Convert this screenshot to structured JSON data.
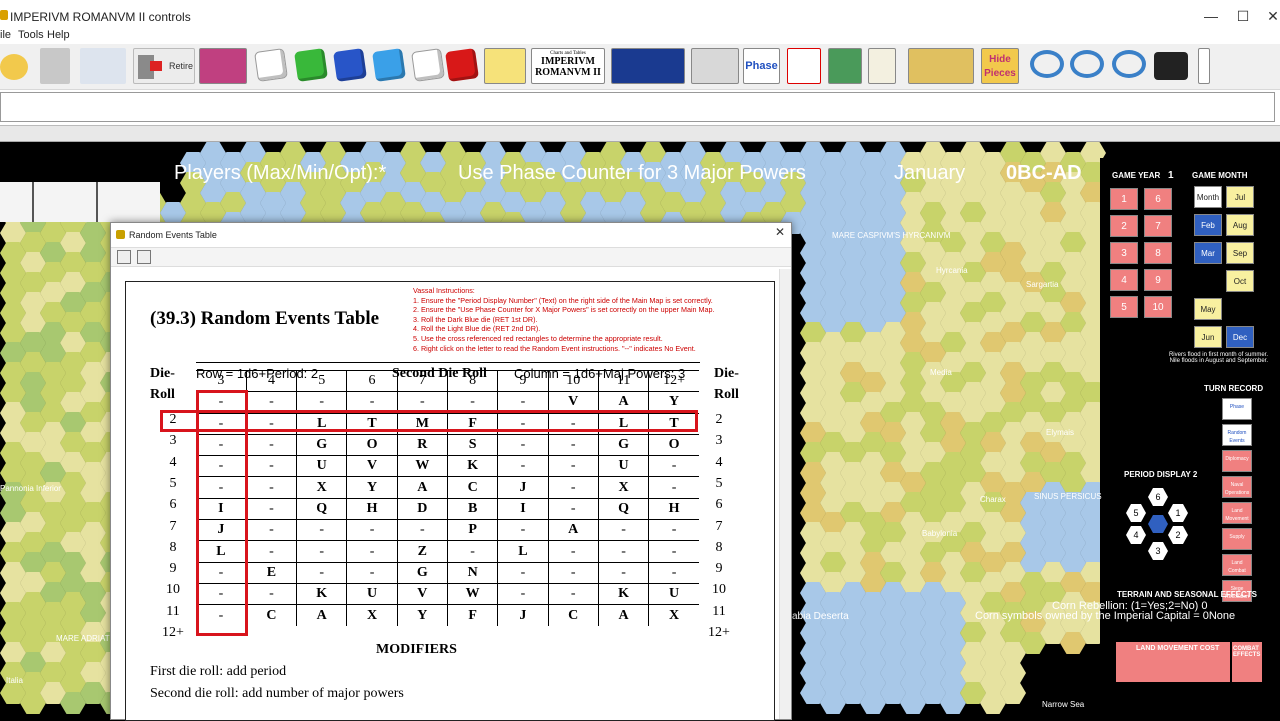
{
  "window": {
    "title": "IMPERIVM ROMANVM II controls",
    "minimize": "—",
    "maximize": "☐",
    "close": "✕"
  },
  "menu": [
    "ile",
    "Tools",
    "Help"
  ],
  "toolbar": {
    "retire_label": "Retire",
    "phase_label": "Phase",
    "charts_label": "Charts and Tables",
    "imperivm_label": "IMPERIVM ROMANVM II",
    "hide_label": "Hide Pieces"
  },
  "map": {
    "players_label": "Players (Max/Min/Opt):*",
    "phase_counter_label": "Use Phase Counter for 3 Major Powers",
    "month": "January",
    "year": "0BC-AD",
    "game_year_label": "GAME YEAR",
    "game_year_value": "1",
    "game_month_label": "GAME MONTH",
    "year_boxes": [
      "1",
      "6",
      "2",
      "7",
      "3",
      "8",
      "4",
      "9",
      "5",
      "10"
    ],
    "month_boxes": [
      "Month",
      "Jul",
      "Feb",
      "Aug",
      "Mar",
      "Sep",
      "Oct",
      "May",
      "Jun",
      "Dec"
    ],
    "nile_note": "Rivers flood in first month of summer. Nile floods in August and September.",
    "turn_record_label": "TURN RECORD",
    "turn_boxes": [
      "Phase",
      "Random Events",
      "Diplomacy",
      "Naval Operations",
      "Land Movement",
      "Supply",
      "Land Combat",
      "Siege Resolution"
    ],
    "period_display_label": "PERIOD DISPLAY 2",
    "period_numbers": [
      "6",
      "5",
      "1",
      "4",
      "2",
      "3"
    ],
    "corn_rebellion": "Corn Rebellion: (1=Yes;2=No) 0",
    "corn_symbols": "Corn  symbols owned by the Imperial Capital = 0None",
    "terrain_label": "TERRAIN AND SEASONAL EFFECTS",
    "land_movement_cost": "LAND MOVEMENT COST",
    "combat_effects": "COMBAT EFFECTS",
    "places": [
      "MARE CASPIVM'S HYRCANIVM",
      "Hyrcania",
      "Sargartia",
      "Media",
      "Elymais",
      "Babylonia",
      "Charax",
      "SINUS PERSICUS",
      "abia Deserta",
      "Pannonia Inferior",
      "MARE ADRIATICUM",
      "Italia",
      "Narrow Sea"
    ],
    "colors": {
      "land": "#c8d36a",
      "land2": "#e6e2a0",
      "sea": "#a8c8e8",
      "deep": "#6aa0d8",
      "box_red": "#f08080",
      "box_blue": "#3060c0",
      "box_yellow": "#f8f0a0"
    }
  },
  "dialog": {
    "title": "Random Events Table",
    "close": "✕",
    "heading": "(39.3) Random Events Table",
    "instructions": [
      "Vassal Instructions:",
      "1.  Ensure the \"Period Display Number\" (Text) on the right side of the Main Map is set correctly.",
      "2.  Ensure the \"Use Phase Counter for X Major Powers\" is set correctly on the upper Main Map.",
      "3.  Roll the Dark Blue die (RET 1st DR).",
      "4.  Roll the Light Blue die (RET 2nd DR).",
      "5.  Use the cross referenced red rectangles to determine the appropriate result.",
      "6.  Right click on the letter to read the Random Event instructions.          \"--\" indicates No Event."
    ],
    "die_roll_left": [
      "Die-",
      "Roll"
    ],
    "die_roll_right": [
      "Die-",
      "Roll"
    ],
    "row_label": "Row = 1d6+Period: 2",
    "second_die_label": "Second Die Roll",
    "column_label": "Column = 1d6+Maj Powers: 3",
    "columns": [
      "3",
      "4",
      "5",
      "6",
      "7",
      "8",
      "9",
      "10",
      "11",
      "12+"
    ],
    "rows": [
      {
        "roll": "2",
        "cells": [
          "-",
          "-",
          "-",
          "-",
          "-",
          "-",
          "-",
          "V",
          "A",
          "Y"
        ]
      },
      {
        "roll": "3",
        "cells": [
          "-",
          "-",
          "L",
          "T",
          "M",
          "F",
          "-",
          "-",
          "L",
          "T"
        ]
      },
      {
        "roll": "4",
        "cells": [
          "-",
          "-",
          "G",
          "O",
          "R",
          "S",
          "-",
          "-",
          "G",
          "O"
        ]
      },
      {
        "roll": "5",
        "cells": [
          "-",
          "-",
          "U",
          "V",
          "W",
          "K",
          "-",
          "-",
          "U",
          "-"
        ]
      },
      {
        "roll": "6",
        "cells": [
          "-",
          "-",
          "X",
          "Y",
          "A",
          "C",
          "J",
          "-",
          "X",
          "-"
        ]
      },
      {
        "roll": "7",
        "cells": [
          "I",
          "-",
          "Q",
          "H",
          "D",
          "B",
          "I",
          "-",
          "Q",
          "H"
        ]
      },
      {
        "roll": "8",
        "cells": [
          "J",
          "-",
          "-",
          "-",
          "-",
          "P",
          "-",
          "A",
          "-",
          "-"
        ]
      },
      {
        "roll": "9",
        "cells": [
          "L",
          "-",
          "-",
          "-",
          "Z",
          "-",
          "L",
          "-",
          "-",
          "-"
        ]
      },
      {
        "roll": "10",
        "cells": [
          "-",
          "E",
          "-",
          "-",
          "G",
          "N",
          "-",
          "-",
          "-",
          "-"
        ]
      },
      {
        "roll": "11",
        "cells": [
          "-",
          "-",
          "K",
          "U",
          "V",
          "W",
          "-",
          "-",
          "K",
          "U"
        ]
      },
      {
        "roll": "12+",
        "cells": [
          "-",
          "C",
          "A",
          "X",
          "Y",
          "F",
          "J",
          "C",
          "A",
          "X"
        ]
      }
    ],
    "modifiers_title": "MODIFIERS",
    "modifier_1": "First die roll: add period",
    "modifier_2": "Second die roll: add number of major powers"
  }
}
